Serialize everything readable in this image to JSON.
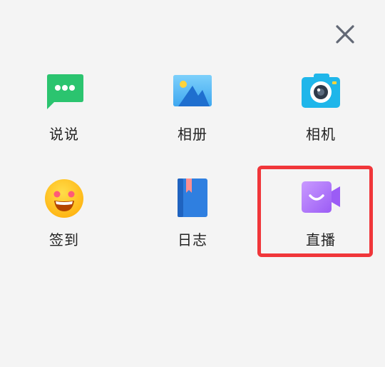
{
  "header": {
    "close_icon": "close-icon"
  },
  "items": [
    {
      "label": "说说",
      "icon": "message-bubble-icon",
      "color": "#2bc46f"
    },
    {
      "label": "相册",
      "icon": "photo-album-icon",
      "color": "#3ea7f0"
    },
    {
      "label": "相机",
      "icon": "camera-icon",
      "color": "#1fb6ea"
    },
    {
      "label": "签到",
      "icon": "smile-emoji-icon",
      "color": "#ffc316"
    },
    {
      "label": "日志",
      "icon": "notebook-icon",
      "color": "#2f7fe0"
    },
    {
      "label": "直播",
      "icon": "live-video-icon",
      "color": "#b779ff"
    }
  ],
  "highlight": {
    "target": "直播",
    "color": "#f0363a"
  }
}
